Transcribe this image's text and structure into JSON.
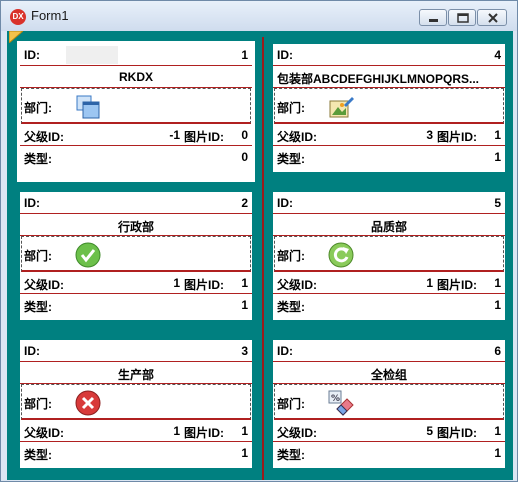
{
  "window": {
    "title": "Form1",
    "app_icon_text": "DX"
  },
  "labels": {
    "id": "ID:",
    "dept": "部门:",
    "parent_id": "父级ID:",
    "pic_id": "图片ID:",
    "type": "类型:"
  },
  "cards": [
    {
      "id": "1",
      "name": "RKDX",
      "icon": "window-stack-icon",
      "parent_id": "-1",
      "pic_id": "0",
      "type": "0"
    },
    {
      "id": "4",
      "name": "包装部ABCDEFGHIJKLMNOPQRS...",
      "icon": "picture-edit-icon",
      "parent_id": "3",
      "pic_id": "1",
      "type": "1"
    },
    {
      "id": "2",
      "name": "行政部",
      "icon": "check-icon",
      "parent_id": "1",
      "pic_id": "1",
      "type": "1"
    },
    {
      "id": "5",
      "name": "品质部",
      "icon": "refresh-icon",
      "parent_id": "1",
      "pic_id": "1",
      "type": "1"
    },
    {
      "id": "3",
      "name": "生产部",
      "icon": "close-circle-icon",
      "parent_id": "1",
      "pic_id": "1",
      "type": "1"
    },
    {
      "id": "6",
      "name": "全检组",
      "icon": "eraser-icon",
      "parent_id": "5",
      "pic_id": "1",
      "type": "1"
    }
  ],
  "colors": {
    "background": "#008080",
    "divider": "#9b1b1b",
    "row_line": "#b02020"
  }
}
